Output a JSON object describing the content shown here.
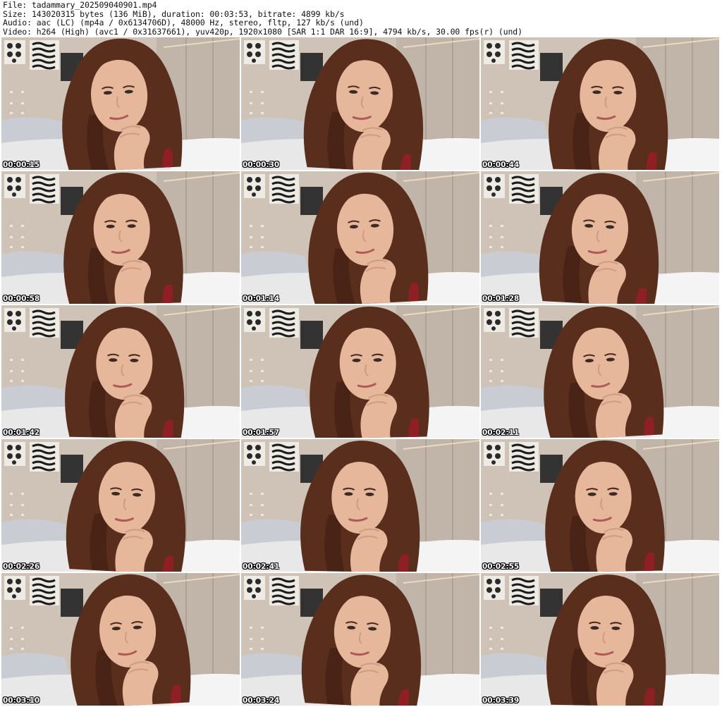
{
  "header": {
    "file_line": "File: tadammary_202509040901.mp4",
    "size_line": "Size: 143020315 bytes (136 MiB), duration: 00:03:53, bitrate: 4899 kb/s",
    "audio_line": "Audio: aac (LC) (mp4a / 0x6134706D), 48000 Hz, stereo, fltp, 127 kb/s (und)",
    "video_line": "Video: h264 (High) (avc1 / 0x31637661), yuv420p, 1920x1080 [SAR 1:1 DAR 16:9], 4794 kb/s, 30.00 fps(r) (und)"
  },
  "colors": {
    "wall": "#cfc3b8",
    "wall_shadow": "#b7aa9e",
    "hair": "#5a2e1c",
    "hair_dark": "#3d1d10",
    "skin": "#e7b79c",
    "skin_shadow": "#cf9c80",
    "bedding": "#e9e8e8",
    "pillow": "#c9cdd3",
    "poster": "#2a2a2a",
    "top": "#8e1f24"
  },
  "thumbnails": [
    {
      "timestamp": "00:00:15",
      "icon": "video-frame-thumbnail"
    },
    {
      "timestamp": "00:00:30",
      "icon": "video-frame-thumbnail"
    },
    {
      "timestamp": "00:00:44",
      "icon": "video-frame-thumbnail"
    },
    {
      "timestamp": "00:00:58",
      "icon": "video-frame-thumbnail"
    },
    {
      "timestamp": "00:01:14",
      "icon": "video-frame-thumbnail"
    },
    {
      "timestamp": "00:01:28",
      "icon": "video-frame-thumbnail"
    },
    {
      "timestamp": "00:01:42",
      "icon": "video-frame-thumbnail"
    },
    {
      "timestamp": "00:01:57",
      "icon": "video-frame-thumbnail"
    },
    {
      "timestamp": "00:02:11",
      "icon": "video-frame-thumbnail"
    },
    {
      "timestamp": "00:02:26",
      "icon": "video-frame-thumbnail"
    },
    {
      "timestamp": "00:02:41",
      "icon": "video-frame-thumbnail"
    },
    {
      "timestamp": "00:02:55",
      "icon": "video-frame-thumbnail"
    },
    {
      "timestamp": "00:03:10",
      "icon": "video-frame-thumbnail"
    },
    {
      "timestamp": "00:03:24",
      "icon": "video-frame-thumbnail"
    },
    {
      "timestamp": "00:03:39",
      "icon": "video-frame-thumbnail"
    }
  ]
}
